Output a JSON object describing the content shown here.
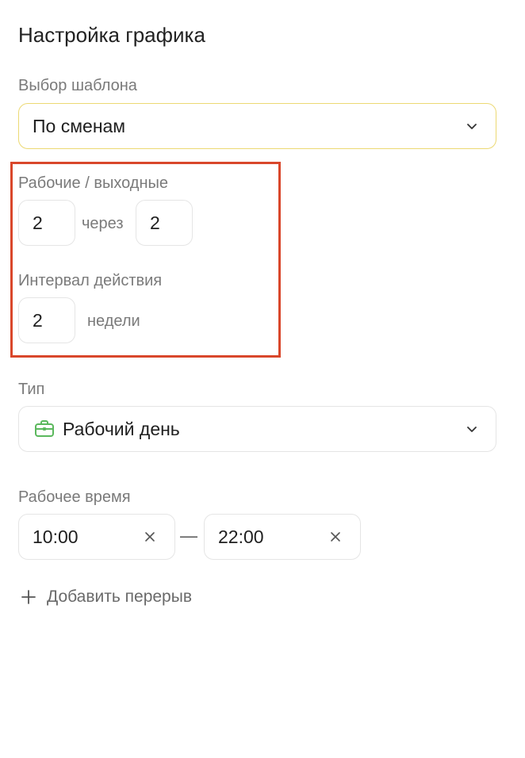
{
  "page_title": "Настройка графика",
  "template": {
    "label": "Выбор шаблона",
    "value": "По сменам"
  },
  "shift": {
    "label": "Рабочие / выходные",
    "work_days": "2",
    "separator": "через",
    "off_days": "2"
  },
  "interval": {
    "label": "Интервал действия",
    "value": "2",
    "unit": "недели"
  },
  "type": {
    "label": "Тип",
    "value": "Рабочий день",
    "icon": "briefcase-icon",
    "icon_color": "#5bb85d"
  },
  "work_time": {
    "label": "Рабочее время",
    "start": "10:00",
    "dash": "—",
    "end": "22:00"
  },
  "add_break": {
    "label": "Добавить перерыв"
  },
  "colors": {
    "highlight": "#d9472b",
    "active_border": "#ecd973"
  }
}
